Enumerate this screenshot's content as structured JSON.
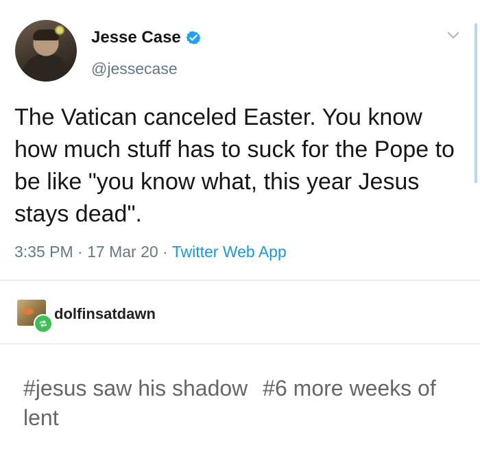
{
  "tweet": {
    "author_name": "Jesse Case",
    "handle": "@jessecase",
    "text": "The Vatican canceled Easter. You know how much stuff has to suck for the Pope to be like \"you know what, this year Jesus stays dead\".",
    "time": "3:35 PM",
    "date": "17 Mar 20",
    "source": "Twitter Web App",
    "separator": " · "
  },
  "reblog": {
    "username": "dolfinsatdawn",
    "tags": [
      "#jesus saw his shadow",
      "#6 more weeks of lent"
    ]
  },
  "icons": {
    "verified": "verified-badge-icon",
    "menu": "chevron-down-icon",
    "reblog": "reblog-icon"
  },
  "colors": {
    "accent": "#1b95e0",
    "reblog_green": "#3fbf55"
  }
}
